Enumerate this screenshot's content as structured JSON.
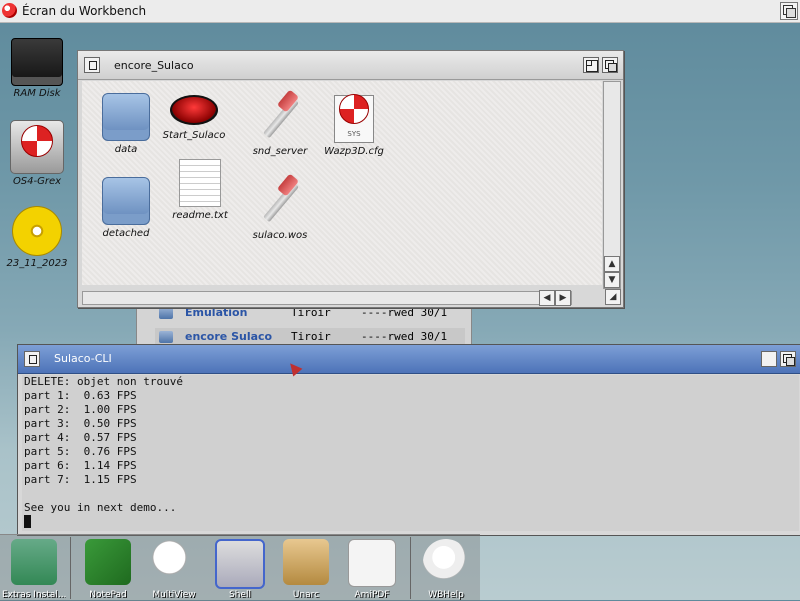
{
  "screen": {
    "title": "Écran du Workbench"
  },
  "desktop_icons": [
    {
      "label": "RAM Disk"
    },
    {
      "label": "OS4-Grex"
    },
    {
      "label": "23_11_2023"
    }
  ],
  "list_window": {
    "rows": [
      {
        "name": "Emulation",
        "type": "Tiroir",
        "prot": "----rwed 30/1"
      },
      {
        "name": "encore Sulaco",
        "type": "Tiroir",
        "prot": "----rwed 30/1"
      }
    ]
  },
  "drawer_window": {
    "title": "encore_Sulaco",
    "icons": [
      {
        "label": "data"
      },
      {
        "label": "Start_Sulaco"
      },
      {
        "label": "snd_server"
      },
      {
        "label": "Wazp3D.cfg",
        "tag": "SYS"
      },
      {
        "label": "detached"
      },
      {
        "label": "readme.txt"
      },
      {
        "label": "sulaco.wos"
      }
    ]
  },
  "cli_window": {
    "title": "Sulaco-CLI",
    "lines": [
      "DELETE: objet non trouvé",
      "part 1:  0.63 FPS",
      "part 2:  1.00 FPS",
      "part 3:  0.50 FPS",
      "part 4:  0.57 FPS",
      "part 5:  0.76 FPS",
      "part 6:  1.14 FPS",
      "part 7:  1.15 FPS",
      "",
      "See you in next demo..."
    ]
  },
  "dock": {
    "items": [
      {
        "label": "Extras Instal..."
      },
      {
        "label": "NotePad"
      },
      {
        "label": "MultiView"
      },
      {
        "label": "Shell"
      },
      {
        "label": "Unarc"
      },
      {
        "label": "AmiPDF"
      },
      {
        "label": "WBHelp"
      }
    ]
  }
}
